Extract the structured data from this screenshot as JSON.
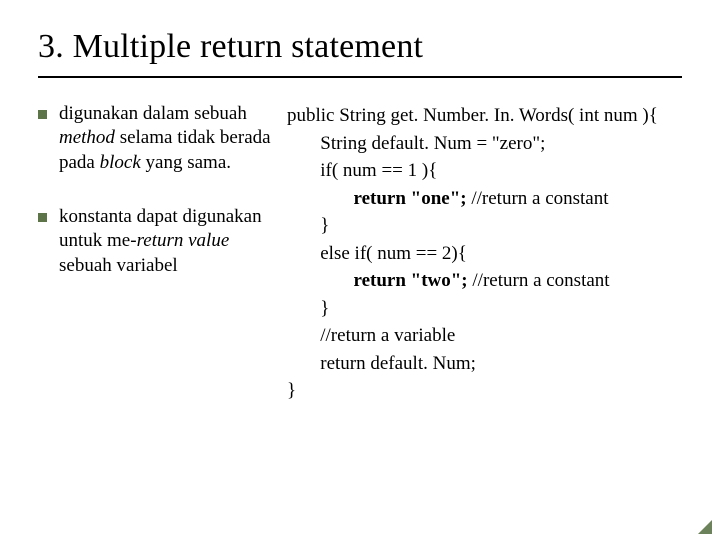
{
  "title": "3. Multiple return statement",
  "bullets": {
    "b1_part1": "digunakan dalam sebuah ",
    "b1_italic1": "method",
    "b1_part2": " selama tidak berada pada ",
    "b1_italic2": "block",
    "b1_part3": " yang sama.",
    "b2_part1": "konstanta dapat digunakan untuk me-",
    "b2_italic1": "return value",
    "b2_part2": " sebuah variabel"
  },
  "code": {
    "l1": "public String get. Number. In. Words( int num ){",
    "l2_pad": "       ",
    "l2": "String default. Num = \"zero\";",
    "l3_pad": "       ",
    "l3": "if( num == 1 ){",
    "l4_pad": "              ",
    "l4a": "return \"one\"; ",
    "l4b": "//return a constant",
    "l5_pad": "       ",
    "l5": "}",
    "l6_pad": "       ",
    "l6": "else if( num == 2){",
    "l7_pad": "              ",
    "l7a": "return \"two\"; ",
    "l7b": "//return a constant",
    "l8_pad": "       ",
    "l8": "}",
    "l9_pad": "       ",
    "l9": "//return a variable",
    "l10_pad": "       ",
    "l10": "return default. Num;",
    "l11": "}"
  }
}
